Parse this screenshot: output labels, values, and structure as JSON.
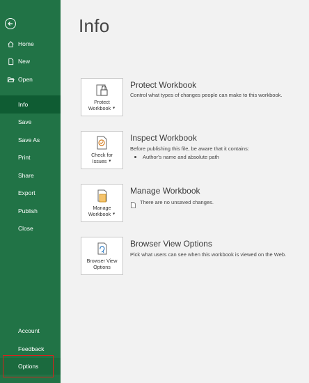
{
  "sidebar": {
    "top_items": [
      {
        "label": "Home",
        "icon": "home-icon"
      },
      {
        "label": "New",
        "icon": "new-file-icon"
      },
      {
        "label": "Open",
        "icon": "folder-open-icon"
      }
    ],
    "items": [
      {
        "label": "Info",
        "selected": true
      },
      {
        "label": "Save"
      },
      {
        "label": "Save As"
      },
      {
        "label": "Print"
      },
      {
        "label": "Share"
      },
      {
        "label": "Export"
      },
      {
        "label": "Publish"
      },
      {
        "label": "Close"
      }
    ],
    "bottom_items": [
      {
        "label": "Account"
      },
      {
        "label": "Feedback"
      },
      {
        "label": "Options",
        "highlighted": true
      }
    ],
    "colors": {
      "background": "#217346",
      "selected": "#0f5c33",
      "highlight_outline": "#d9221c"
    }
  },
  "main": {
    "title": "Info",
    "sections": [
      {
        "tile_label_1": "Protect",
        "tile_label_2": "Workbook",
        "tile_icon": "lock-icon",
        "title": "Protect Workbook",
        "description": "Control what types of changes people can make to this workbook."
      },
      {
        "tile_label_1": "Check for",
        "tile_label_2": "Issues",
        "tile_icon": "inspect-document-icon",
        "title": "Inspect Workbook",
        "description": "Before publishing this file, be aware that it contains:",
        "bullets": [
          "Author's name and absolute path"
        ]
      },
      {
        "tile_label_1": "Manage",
        "tile_label_2": "Workbook",
        "tile_icon": "manage-workbook-icon",
        "title": "Manage Workbook",
        "description": "There are no unsaved changes.",
        "desc_icon": "document-small-icon"
      },
      {
        "tile_label_1": "Browser View",
        "tile_label_2": "Options",
        "tile_icon": "browser-view-icon",
        "title": "Browser View Options",
        "description": "Pick what users can see when this workbook is viewed on the Web."
      }
    ]
  }
}
